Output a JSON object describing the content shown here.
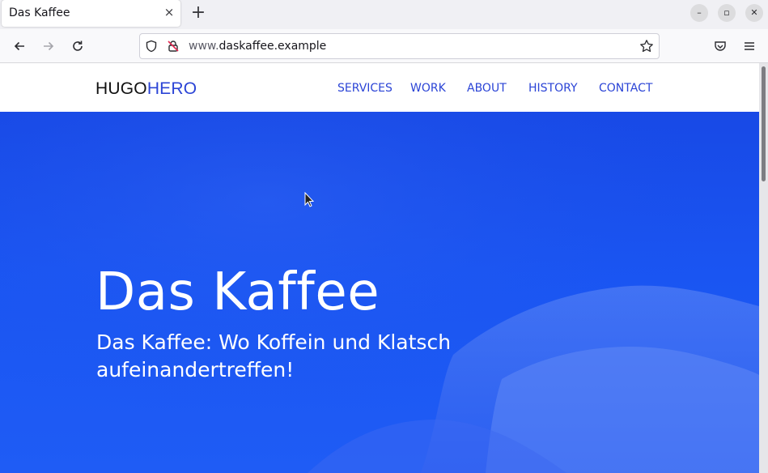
{
  "browser": {
    "tab_title": "Das Kaffee",
    "tab_close": "×",
    "new_tab": "+",
    "url_dim": "www.",
    "url_main": "daskaffee.example",
    "window_minimize": "–",
    "window_restore": "▫",
    "window_close": "✕"
  },
  "site": {
    "logo_part1": "HUGO",
    "logo_part2": "HERO",
    "nav": [
      "SERVICES",
      "WORK",
      "ABOUT",
      "HISTORY",
      "CONTACT"
    ],
    "hero_title": "Das Kaffee",
    "hero_subtitle": "Das Kaffee: Wo Koffein und Klatsch aufeinandertreffen!"
  },
  "colors": {
    "brand_blue": "#2b44d6",
    "hero_blue": "#1a55f2"
  },
  "icons": [
    "back-icon",
    "forward-icon",
    "reload-icon",
    "shield-icon",
    "lock-insecure-icon",
    "star-icon",
    "pocket-icon",
    "menu-icon"
  ]
}
